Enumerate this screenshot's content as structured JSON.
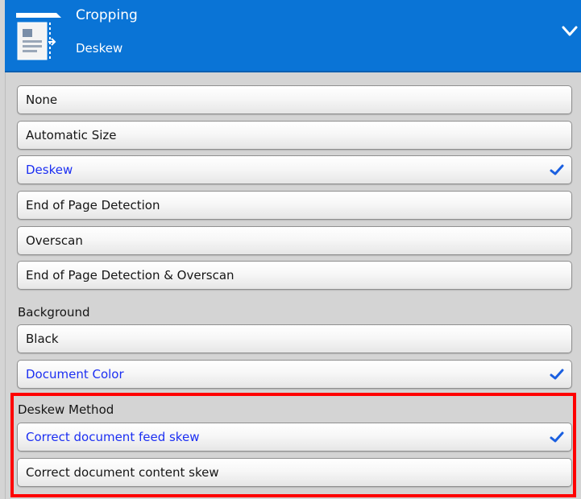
{
  "header": {
    "title": "Cropping",
    "subtitle": "Deskew",
    "icon": "document-crop-icon",
    "expand_icon": "chevron-down-icon",
    "color": "#0a74d6"
  },
  "cropping_options": [
    {
      "label": "None",
      "selected": false
    },
    {
      "label": "Automatic Size",
      "selected": false
    },
    {
      "label": "Deskew",
      "selected": true
    },
    {
      "label": "End of Page Detection",
      "selected": false
    },
    {
      "label": "Overscan",
      "selected": false
    },
    {
      "label": "End of Page Detection & Overscan",
      "selected": false
    }
  ],
  "background": {
    "label": "Background",
    "options": [
      {
        "label": "Black",
        "selected": false
      },
      {
        "label": "Document Color",
        "selected": true
      }
    ]
  },
  "deskew_method": {
    "label": "Deskew Method",
    "options": [
      {
        "label": "Correct document feed skew",
        "selected": true
      },
      {
        "label": "Correct document content skew",
        "selected": false
      }
    ]
  },
  "colors": {
    "selected_text": "#1c2ff2",
    "check": "#1a5fe0",
    "highlight": "#ff0000"
  }
}
